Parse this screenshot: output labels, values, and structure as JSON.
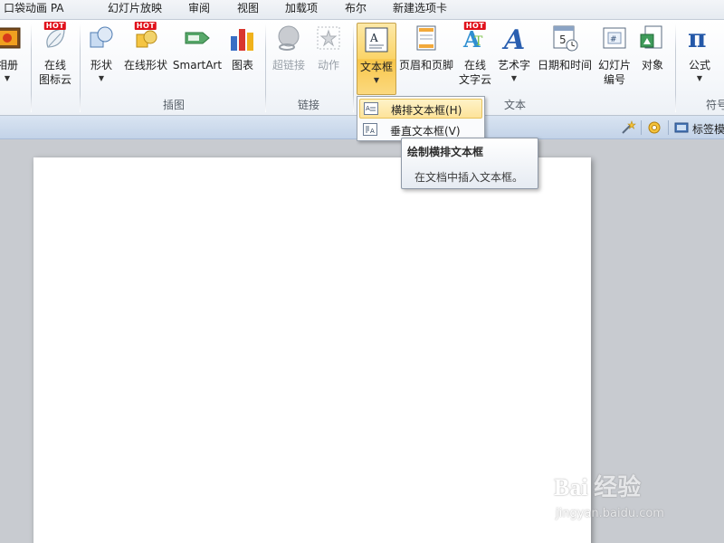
{
  "tabs": [
    {
      "label": "口袋动画 PA"
    },
    {
      "label": "幻灯片放映"
    },
    {
      "label": "审阅"
    },
    {
      "label": "视图"
    },
    {
      "label": "加载项"
    },
    {
      "label": "布尔"
    },
    {
      "label": "新建选项卡"
    }
  ],
  "ribbon": {
    "album": {
      "label": "相册"
    },
    "online_icon_cloud": {
      "line1": "在线",
      "line2": "图标云",
      "badge": "HOT"
    },
    "shapes": {
      "label": "形状"
    },
    "online_shapes": {
      "label": "在线形状",
      "badge": "HOT"
    },
    "smartart": {
      "label": "SmartArt"
    },
    "chart": {
      "label": "图表"
    },
    "hyperlink": {
      "label": "超链接"
    },
    "action": {
      "label": "动作"
    },
    "textbox": {
      "label": "文本框"
    },
    "header_footer": {
      "label": "页眉和页脚"
    },
    "online_text_cloud": {
      "line1": "在线",
      "line2": "文字云",
      "badge": "HOT"
    },
    "wordart": {
      "label": "艺术字"
    },
    "date_time": {
      "label": "日期和时间"
    },
    "slide_number": {
      "line1": "幻灯片",
      "line2": "编号"
    },
    "object": {
      "label": "对象"
    },
    "formula": {
      "label": "公式"
    },
    "groups": {
      "illustrations": "插图",
      "links": "链接",
      "text": "文本",
      "symbols": "符号"
    }
  },
  "quickbar": {
    "tag_label": "标签模"
  },
  "textbox_menu": {
    "items": [
      {
        "label": "横排文本框(H)",
        "highlighted": true
      },
      {
        "label": "垂直文本框(V)",
        "highlighted": false
      }
    ]
  },
  "tooltip": {
    "title": "绘制横排文本框",
    "description": "在文档中插入文本框。"
  },
  "watermark": {
    "brand": "Bai 经验",
    "url": "jingyan.baidu.com"
  },
  "colors": {
    "accent_active": "#fbd468",
    "ribbon_bg": "#f6f8fb",
    "workspace": "#c8cbd0",
    "hot_badge": "#e0101a"
  }
}
